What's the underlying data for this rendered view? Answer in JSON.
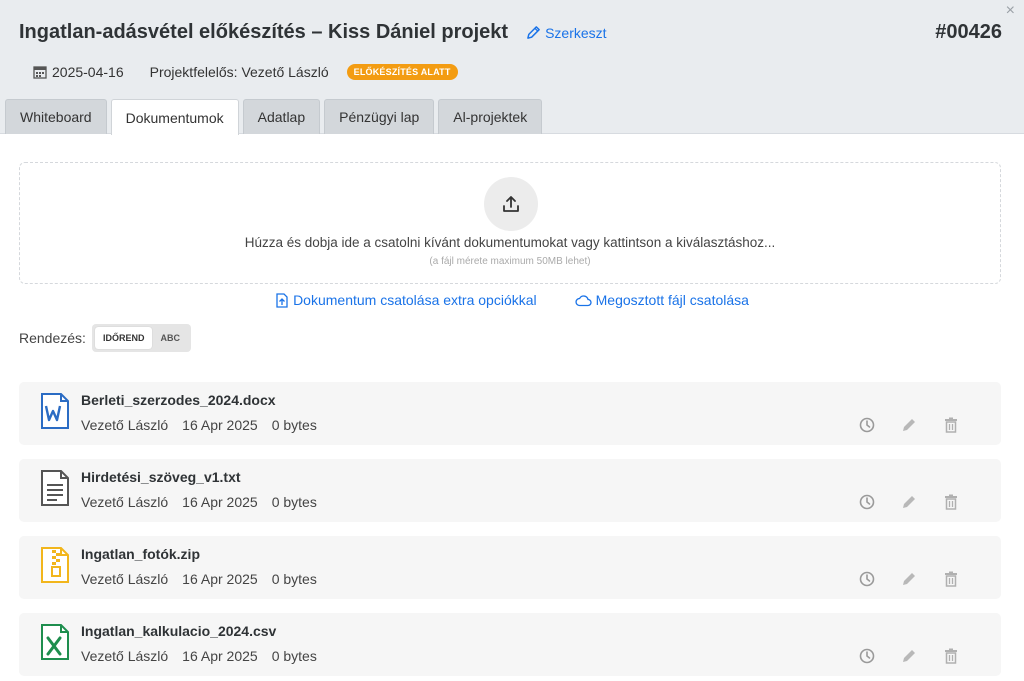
{
  "header": {
    "title": "Ingatlan-adásvétel előkészítés – Kiss Dániel projekt",
    "edit_label": "Szerkeszt",
    "project_id": "#00426",
    "close_label": "×",
    "date": "2025-04-16",
    "owner": "Projektfelelős: Vezető László",
    "status": "ELŐKÉSZÍTÉS ALATT",
    "status_color": "#f39c12"
  },
  "tabs": [
    {
      "label": "Whiteboard",
      "active": false
    },
    {
      "label": "Dokumentumok",
      "active": true
    },
    {
      "label": "Adatlap",
      "active": false
    },
    {
      "label": "Pénzügyi lap",
      "active": false
    },
    {
      "label": "Al-projektek",
      "active": false
    }
  ],
  "upload": {
    "icon": "upload-icon",
    "text": "Húzza és dobja ide a csatolni kívánt dokumentumokat vagy kattintson a kiválasztáshoz...",
    "subtext": "(a fájl mérete maximum 50MB lehet)"
  },
  "attach_links": {
    "extra_options": "Dokumentum csatolása extra opciókkal",
    "shared_file": "Megosztott fájl csatolása"
  },
  "sort": {
    "label": "Rendezés:",
    "options": [
      "IDŐREND",
      "ABC"
    ],
    "selected": "IDŐREND"
  },
  "files": [
    {
      "name": "Berleti_szerzodes_2024.docx",
      "author": "Vezető László",
      "date": "16 Apr 2025",
      "size": "0 bytes",
      "icon": "word-file-icon",
      "color": "#2b6cc4"
    },
    {
      "name": "Hirdetési_szöveg_v1.txt",
      "author": "Vezető László",
      "date": "16 Apr 2025",
      "size": "0 bytes",
      "icon": "text-file-icon",
      "color": "#555555"
    },
    {
      "name": "Ingatlan_fotók.zip",
      "author": "Vezető László",
      "date": "16 Apr 2025",
      "size": "0 bytes",
      "icon": "zip-file-icon",
      "color": "#f2b61c"
    },
    {
      "name": "Ingatlan_kalkulacio_2024.csv",
      "author": "Vezető László",
      "date": "16 Apr 2025",
      "size": "0 bytes",
      "icon": "excel-file-icon",
      "color": "#1e8e4e"
    }
  ],
  "colors": {
    "accent": "#1a73e8",
    "header_bg": "#e9ecef",
    "card_bg": "#f6f6f6"
  }
}
